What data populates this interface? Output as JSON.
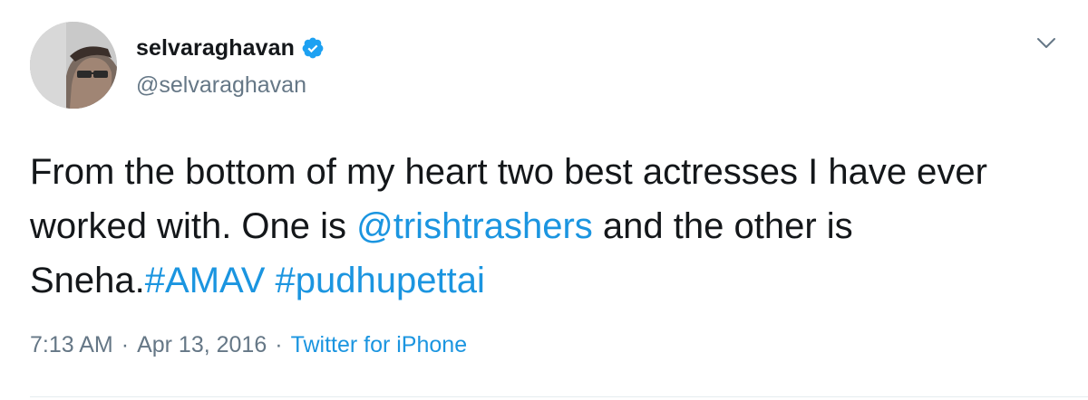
{
  "author": {
    "display_name": "selvaraghavan",
    "handle": "@selvaraghavan",
    "verified": true,
    "avatar_icon": "avatar-photo"
  },
  "tweet": {
    "text_segments": [
      {
        "text": "From the bottom of my heart two best actresses I have ever worked with. One is ",
        "type": "text"
      },
      {
        "text": "@trishtrashers",
        "type": "mention"
      },
      {
        "text": " and the other is Sneha.",
        "type": "text"
      },
      {
        "text": "#AMAV",
        "type": "hashtag"
      },
      {
        "text": " ",
        "type": "text"
      },
      {
        "text": "#pudhupettai",
        "type": "hashtag"
      }
    ]
  },
  "meta": {
    "time": "7:13 AM",
    "separator": "·",
    "date": "Apr 13, 2016",
    "source": "Twitter for iPhone"
  },
  "icons": {
    "verified": "verified-badge-icon",
    "menu": "chevron-down-icon"
  },
  "colors": {
    "link": "#1b95e0",
    "secondary_text": "#657786",
    "primary_text": "#14171a",
    "verified_badge": "#1da1f2"
  }
}
